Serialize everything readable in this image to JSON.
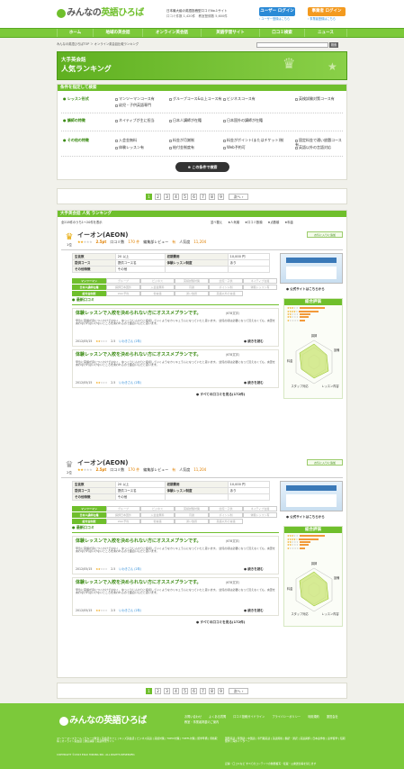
{
  "site": {
    "logo_text_prefix": "みんなの",
    "logo_text_main": "英語ひろば",
    "tagline": "日本最大級の英語投稿型口コミNo.1サイト",
    "stats": "口コミ件数 1,420件　教室登録数 5,600件",
    "login_user": "ユーザー ログイン",
    "login_school": "事業者 ログイン",
    "register_user": "› ユーザー登録はこちら",
    "register_school": "› 事業者登録はこちら"
  },
  "nav": [
    "ホーム",
    "地域の英会話",
    "オンライン英会話",
    "英語学習サイト",
    "口コミ検索",
    "ニュース"
  ],
  "breadcrumb": "みんなの英語ひろばTOP ＞ オンライン英会話比較ランキング",
  "search_btn": "検索",
  "hero": {
    "line1": "大手英会話",
    "line2": "人気ランキング"
  },
  "filter": {
    "header": "条件を指定して検索",
    "rows": [
      {
        "label": "レッスン形式",
        "items": [
          "マンツーマンコース有",
          "グループコース&以上コース有",
          "ビジネスコース有",
          "英検試験対策コース有",
          "幼児・子供英語専門"
        ]
      },
      {
        "label": "講師の特徴",
        "items": [
          "ネイティブが主に担当",
          "日本人講師が在籍",
          "日本国外の講師が在籍"
        ]
      },
      {
        "label": "その他の特徴",
        "items": [
          "入会金無料",
          "料金が月謝制",
          "料金がポイント(またはチケット)制",
          "固定料金で通い放題コース有",
          "体験レッスン有",
          "給付金制度有",
          "Web予約可",
          "英語以外の言語対応"
        ]
      }
    ],
    "submit": "この条件で検索"
  },
  "pagination": {
    "pages": [
      "1",
      "2",
      "3",
      "4",
      "5",
      "6",
      "7",
      "8",
      "9"
    ],
    "next": "次へ ›"
  },
  "ranking": {
    "header": "大手英会話 人気 ランキング",
    "count": "全218件のうち1〜20件を表示",
    "sort_label": "並べ替え",
    "sort": [
      "人気順",
      "口コミ数順",
      "点数順",
      "料金"
    ]
  },
  "schools": [
    {
      "rank": "1位",
      "name": "イーオン(AEON)",
      "score": "2.5pt",
      "reviews_label": "口コミ数",
      "reviews": "170 件",
      "editor_label": "編集部レビュー",
      "editor": "有",
      "pop_label": "人気度",
      "pop": "11,204",
      "fav": "お気に入りに追加",
      "info": [
        [
          "生徒数",
          "20 以上",
          "初期費用",
          "10,000 円"
        ],
        [
          "提供コース",
          "提供コース名",
          "体験レッスン制度",
          "あり"
        ],
        [
          "その他特徴",
          "その他",
          "",
          ""
        ]
      ],
      "tags": [
        [
          "マンツーマン",
          "グループ",
          "ビジネス",
          "英検試験対策",
          "幼児・子供",
          "ネイティブ在籍"
        ],
        [
          "日本人講師在籍",
          "講師日本国外",
          "入会金無料",
          "月謝",
          "ポイント制",
          "体験レッスン有"
        ],
        [
          "給付金制度",
          "Web予約",
          "他言語",
          "通い放題",
          "英語以外の言語",
          "",
          ""
        ]
      ],
      "official": "公式サイトはこちらから",
      "latest_label": "最新口コミ",
      "review_title": "体験レッスンで入校を決められない方にオススメプランです。",
      "review_chars": "(678文字)",
      "review_body": "早急に英語が身につくわけではなく、ゆっくりじんわりと吸収していくようなカリキュラムになっていたと思います。 幼児の頃は必要になって覚えなくても、言葉を言わなければいけないところを言われるので面白いんだと思います。",
      "review_date": "2012/05/15",
      "review_score": "2.5",
      "review_user": "いわきさん (2年)",
      "more": "続きを読む",
      "all_reviews": "すべての口コミを見る(172件)",
      "eval_header": "総合評価",
      "eval_items": [
        "料金",
        "講師の質",
        "教材",
        "雰囲気",
        "アクセス"
      ],
      "radar_labels": [
        "講師",
        "設備",
        "スタッフ対応",
        "レッスン内容",
        "料金",
        "立地・環境"
      ]
    },
    {
      "rank": "2位",
      "name": "イーオン(AEON)",
      "score": "2.5pt",
      "reviews_label": "口コミ数",
      "reviews": "170 件",
      "editor_label": "編集部レビュー",
      "editor": "有",
      "pop_label": "人気度",
      "pop": "11,204",
      "fav": "お気に入りに追加",
      "info": [
        [
          "生徒数",
          "20 以上",
          "初期費用",
          "10,000 円"
        ],
        [
          "提供コース",
          "提供コース名",
          "体験レッスン制度",
          "あり"
        ],
        [
          "その他特徴",
          "その他",
          "",
          ""
        ]
      ],
      "tags": [
        [
          "マンツーマン",
          "グループ",
          "ビジネス",
          "英検試験対策",
          "幼児・子供",
          "ネイティブ在籍"
        ],
        [
          "日本人講師在籍",
          "講師日本国外",
          "入会金無料",
          "月謝",
          "ポイント制",
          "体験レッスン有"
        ],
        [
          "給付金制度",
          "Web予約",
          "他言語",
          "通い放題",
          "英語以外の言語",
          "",
          ""
        ]
      ],
      "official": "公式サイトはこちらから",
      "latest_label": "最新口コミ",
      "review_title": "体験レッスンで入校を決められない方にオススメプランです。",
      "review_chars": "(678文字)",
      "review_body": "早急に英語が身につくわけではなく、ゆっくりじんわりと吸収していくようなカリキュラムになっていたと思います。 幼児の頃は必要になって覚えなくても、言葉を言わなければいけないところを言われるので面白いんだと思います。",
      "review_date": "2012/05/15",
      "review_score": "2.5",
      "review_user": "いわきさん (2年)",
      "more": "続きを読む",
      "all_reviews": "すべての口コミを見る(172件)",
      "eval_header": "総合評価",
      "eval_items": [
        "料金",
        "講師の質",
        "教材",
        "雰囲気",
        "アクセス"
      ],
      "radar_labels": [
        "講師",
        "設備",
        "スタッフ対応",
        "レッスン内容",
        "料金",
        "立地・環境"
      ]
    }
  ],
  "footer": {
    "logo_prefix": "みんなの",
    "logo_main": "英語ひろば",
    "links": [
      "お問い合わせ",
      "よくある質問",
      "口コミ投稿ガイドライン",
      "プライバシーポリシー",
      "利用規約",
      "運営会社",
      "教室・事業者掲載のご案内"
    ],
    "cat_text": "マンツーマンスクール | グループ教室 | 英会話カフェ | キッズ英会話 | ビジネス英語 | 英検対策 | TOEIC対策 | TOEFL対策 | 留学準備 | 資格取得 | オンライン英会話 | 通信講座 | 英語学習サイト",
    "cat_text2": "国際英語 | 韓国語 | 中国語 | 専門職英語 | 英語資格 | 翻訳・通訳 | 英語講師 | 日本語学校 | 語学留学 | 短期留学 | 海外インターン",
    "copyright": "COPYRIGHT ©2013 EIGO HIROBA INC. ALL RIGHTS RESERVED.",
    "notice": "記事・口コミなど すべてのコンテンツの無断複写・転載・公衆送信等を禁じます"
  },
  "colors": {
    "green": "#6fbf2c",
    "blue": "#2b8ad6",
    "orange": "#f39a1f"
  }
}
